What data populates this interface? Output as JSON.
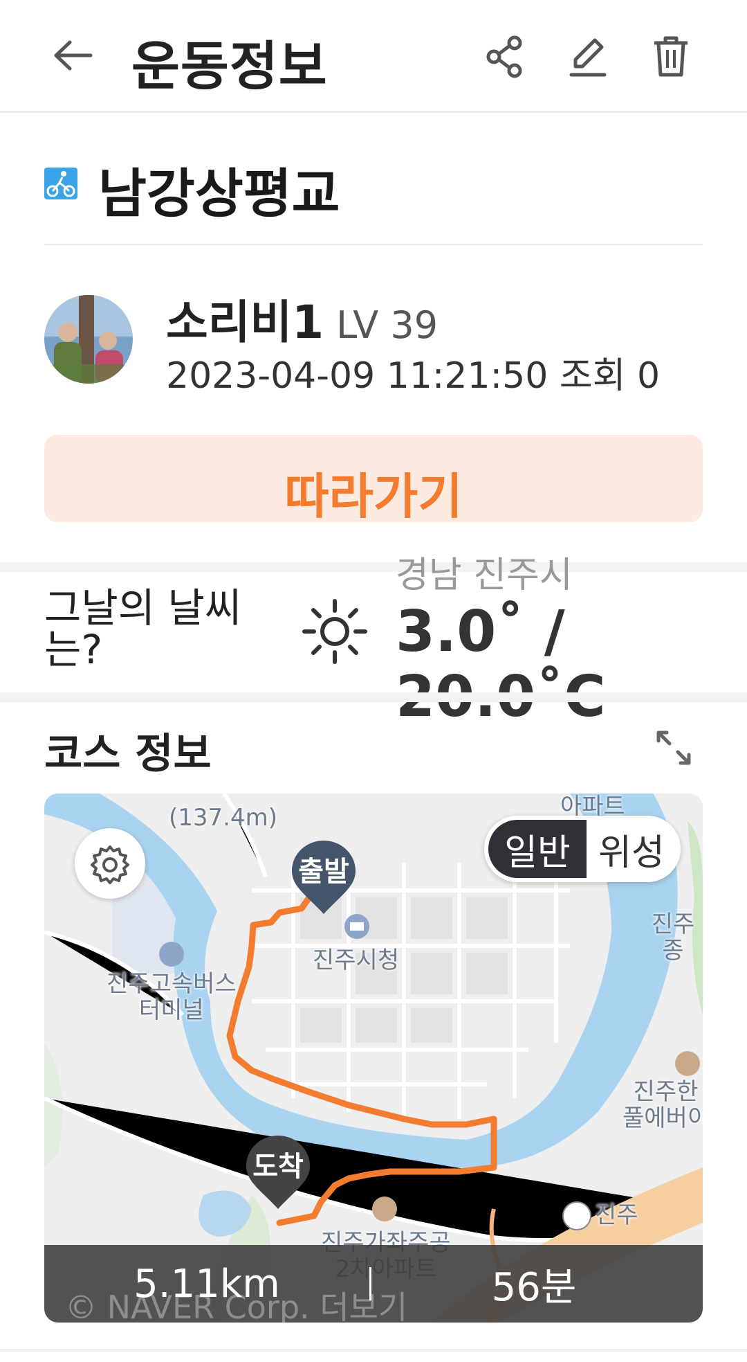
{
  "header": {
    "title": "운동정보",
    "icons": [
      "back-arrow-icon",
      "share-icon",
      "edit-icon",
      "trash-icon"
    ]
  },
  "course": {
    "icon": "cycling-icon",
    "title": "남강상평교"
  },
  "user": {
    "name": "소리비1",
    "level": "LV 39",
    "meta": "2023-04-09 11:21:50 조회 0"
  },
  "follow_button": {
    "label": "따라가기"
  },
  "weather": {
    "label": "그날의 날씨는?",
    "location": "경남 진주시",
    "temp_line1": "3.0˚ /",
    "temp_line2": "20.0˚C",
    "icon": "sun-icon"
  },
  "course_info": {
    "title": "코스 정보",
    "map": {
      "toggle_active": "일반",
      "toggle_inactive": "위성",
      "start_label": "출발",
      "end_label": "도착",
      "place_labels": {
        "peak": "(137.4m)",
        "apt_top": "아파트",
        "city_hall": "진주시청",
        "bus_terminal": "진주고속버스\n터미널",
        "jinju_jong": "진주종",
        "jinju_han": "진주한\n풀에버이",
        "ic": "진주",
        "apt_bottom": "진주가좌주공\n2차아파트"
      },
      "copyright": "© NAVER Corp.  더보기",
      "route_color": "#f47c2f"
    },
    "stats": {
      "distance": "5.11km",
      "duration": "56분"
    }
  }
}
